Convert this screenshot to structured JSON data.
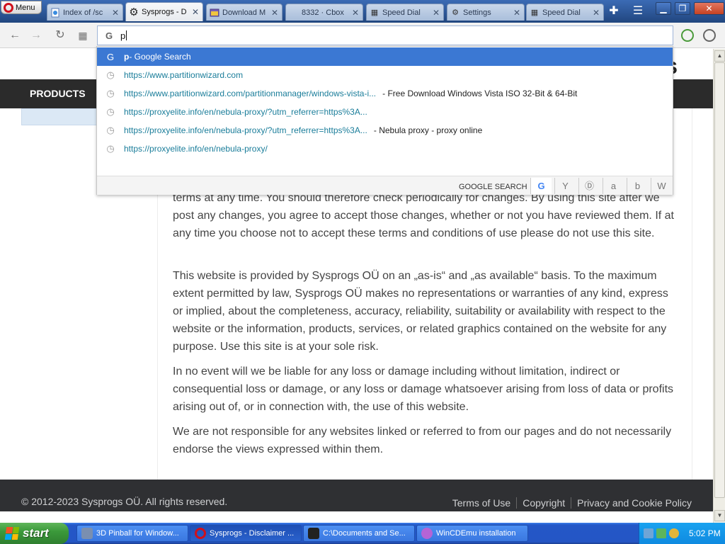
{
  "browser": {
    "menu_label": "Menu",
    "tabs": [
      {
        "title": "Index of /sc",
        "icon": "ie-page-icon",
        "active": false
      },
      {
        "title": "Sysprogs - D",
        "icon": "gear-icon",
        "active": true
      },
      {
        "title": "Download M",
        "icon": "window-icon",
        "active": false
      },
      {
        "title": "8332 · Cbox",
        "icon": "",
        "active": false
      },
      {
        "title": "Speed Dial",
        "icon": "grid-icon",
        "active": false
      },
      {
        "title": "Settings",
        "icon": "gear-icon",
        "active": false
      },
      {
        "title": "Speed Dial",
        "icon": "grid-icon",
        "active": false
      }
    ],
    "address_value": "p"
  },
  "dropdown": {
    "suggestions": [
      {
        "type": "search",
        "url": "p",
        "desc": " - Google Search",
        "selected": true
      },
      {
        "type": "history",
        "url": "https://www.partitionwizard.com",
        "desc": ""
      },
      {
        "type": "history",
        "url": "https://www.partitionwizard.com/partitionmanager/windows-vista-i...",
        "desc": "- Free Download Windows Vista ISO 32-Bit & 64-Bit"
      },
      {
        "type": "history",
        "url": "https://proxyelite.info/en/nebula-proxy/?utm_referrer=https%3A...",
        "desc": ""
      },
      {
        "type": "history",
        "url": "https://proxyelite.info/en/nebula-proxy/?utm_referrer=https%3A...",
        "desc": "- Nebula proxy - proxy online"
      },
      {
        "type": "history",
        "url": "https://proxyelite.info/en/nebula-proxy/",
        "desc": ""
      }
    ],
    "engine_label": "GOOGLE SEARCH",
    "engines": [
      "G",
      "Y",
      "Ⓓ",
      "a",
      "b",
      "W"
    ]
  },
  "page": {
    "logo_fragment": "s",
    "nav_products": "PRODUCTS",
    "paragraphs": [
      "terms at any time. You should therefore check periodically for changes. By using this site after we post any changes, you agree to accept those changes, whether or not you have reviewed them. If at any time you choose not to accept these terms and conditions of use please do not use this site.",
      "This website is provided by Sysprogs OÜ on an „as-is“ and „as available“ basis. To the maximum extent permitted by law, Sysprogs OÜ makes no representations or warranties of any kind, express or implied, about the completeness, accuracy, reliability, suitability or availability with respect to the website or the information, products, services, or related graphics contained on the website for any purpose. Use this site is at your sole risk.",
      "In no event will we be liable for any loss or damage including without limitation, indirect or consequential loss or damage, or any loss or damage whatsoever arising from loss of data or profits arising out of, or in connection with, the use of this website.",
      "We are not responsible for any websites linked or referred to from our pages and do not necessarily endorse the views expressed within them."
    ],
    "footer": {
      "copyright": "© 2012-2023 Sysprogs OÜ. All rights reserved.",
      "links": [
        "Terms of Use",
        "Copyright",
        "Privacy and Cookie Policy"
      ]
    }
  },
  "taskbar": {
    "start_label": "start",
    "tasks": [
      {
        "label": "3D Pinball for Window...",
        "active": false
      },
      {
        "label": "Sysprogs - Disclaimer ...",
        "active": true
      },
      {
        "label": "C:\\Documents and Se...",
        "active": false
      },
      {
        "label": "WinCDEmu installation",
        "active": false
      }
    ],
    "clock": "5:02 PM"
  },
  "colors": {
    "selection": "#3b78d3",
    "url_text": "#1a7d9a",
    "navbar": "#2b2b2b",
    "footer": "#2f3033",
    "taskbar": "#2456c5"
  }
}
